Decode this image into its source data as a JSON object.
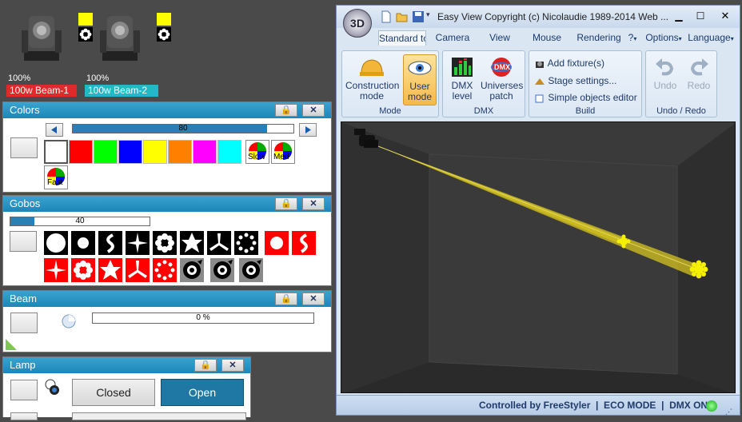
{
  "fixtures": [
    {
      "name": "100w Beam-1",
      "percent": "100%",
      "label_color": "#e02a2a"
    },
    {
      "name": "100w Beam-2",
      "percent": "100%",
      "label_color": "#22b8c8"
    }
  ],
  "colors_panel": {
    "title": "Colors",
    "slider_value": "80",
    "slider_fraction": 0.8,
    "swatches": [
      "#ffffff",
      "#ff0000",
      "#00ff00",
      "#0000ff",
      "#ffff00",
      "#ff8000",
      "#ff00ff",
      "#00ffff"
    ],
    "speed_buttons": [
      "Slow",
      "Med",
      "Fast"
    ]
  },
  "gobos_panel": {
    "title": "Gobos",
    "slider_value": "40",
    "slider_fraction": 0.4
  },
  "beam_panel": {
    "title": "Beam",
    "value": "0 %"
  },
  "lamp_panel": {
    "title": "Lamp",
    "closed_label": "Closed",
    "open_label": "Open"
  },
  "window": {
    "title": "Easy View   Copyright (c) Nicolaudie 1989-2014   Web ...",
    "tabs": [
      "Standard tc",
      "Camera",
      "View",
      "Mouse",
      "Rendering"
    ],
    "menu_right": [
      "?",
      "Options",
      "Language"
    ],
    "groups": {
      "mode": {
        "label": "Mode",
        "buttons": [
          "Construction mode",
          "User mode"
        ]
      },
      "dmx": {
        "label": "DMX",
        "buttons": [
          "DMX level",
          "Universes patch"
        ]
      },
      "build": {
        "label": "Build",
        "items": [
          "Add fixture(s)",
          "Stage settings...",
          "Simple objects editor"
        ]
      },
      "undo": {
        "label": "Undo / Redo",
        "buttons": [
          "Undo",
          "Redo"
        ]
      }
    }
  },
  "status_bar": "Controlled by FreeStyler  |  ECO MODE  |  DMX ON"
}
